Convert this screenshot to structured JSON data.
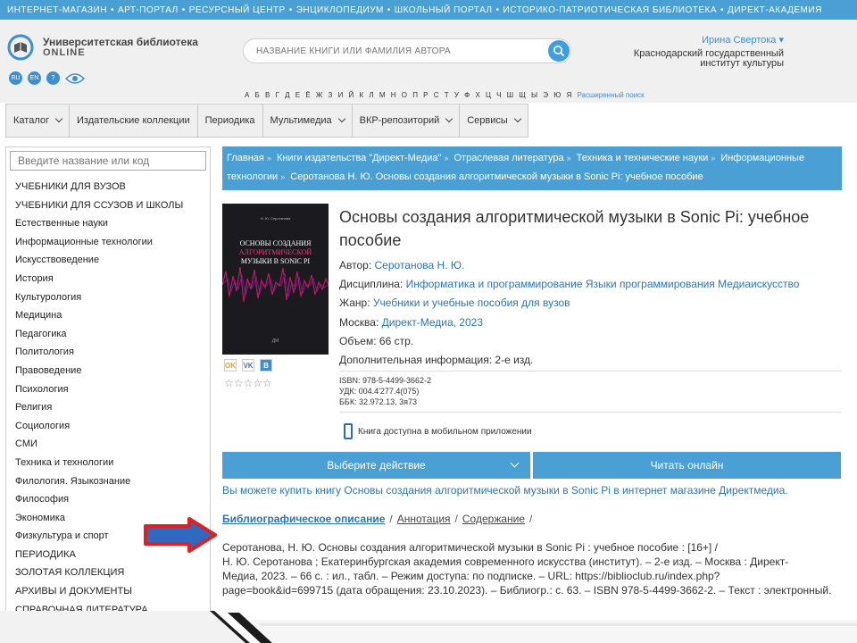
{
  "topbar": [
    "ИНТЕРНЕТ-МАГАЗИН",
    "АРТ-ПОРТАЛ",
    "РЕСУРСНЫЙ ЦЕНТР",
    "ЭНЦИКЛОПЕДИУМ",
    "ШКОЛЬНЫЙ ПОРТАЛ",
    "ИСТОРИКО-ПАТРИОТИЧЕСКАЯ БИБЛИОТЕКА",
    "ДИРЕКТ-АКАДЕМИЯ"
  ],
  "logo": {
    "line1": "Университетская библиотека",
    "line2": "ONLINE"
  },
  "langs": [
    "RU",
    "EN",
    "?"
  ],
  "search": {
    "placeholder": "НАЗВАНИЕ КНИГИ ИЛИ ФАМИЛИЯ АВТОРА"
  },
  "alphabet": "А Б В Г Д Е Ё Ж З И Й К Л М Н О П Р С Т У Ф Х Ц Ч Ш Щ Ы Э Ю Я",
  "advanced_search": "Расширенный поиск",
  "user": {
    "name": "Ирина Свертока ▾",
    "org1": "Краснодарский государственный",
    "org2": "институт культуры"
  },
  "nav": [
    {
      "label": "Каталог",
      "dropdown": true
    },
    {
      "label": "Издательские коллекции",
      "dropdown": false
    },
    {
      "label": "Периодика",
      "dropdown": false
    },
    {
      "label": "Мультимедиа",
      "dropdown": true
    },
    {
      "label": "ВКР-репозиторий",
      "dropdown": true
    },
    {
      "label": "Сервисы",
      "dropdown": true
    }
  ],
  "sidebar": {
    "placeholder": "Введите название или код",
    "items": [
      "УЧЕБНИКИ ДЛЯ ВУЗОВ",
      "УЧЕБНИКИ ДЛЯ ССУЗОВ И ШКОЛЫ",
      "Естественные науки",
      "Информационные технологии",
      "Искусствоведение",
      "История",
      "Культурология",
      "Медицина",
      "Педагогика",
      "Политология",
      "Правоведение",
      "Психология",
      "Религия",
      "Социология",
      "СМИ",
      "Техника и технологии",
      "Филология. Языкознание",
      "Философия",
      "Экономика",
      "Физкультура и спорт",
      "ПЕРИОДИКА",
      "ЗОЛОТАЯ КОЛЛЕКЦИЯ",
      "АРХИВЫ И ДОКУМЕНТЫ",
      "СПРАВОЧНАЯ ЛИТЕРАТУРА"
    ]
  },
  "breadcrumb": {
    "line1": [
      "Главная",
      "Книги издательства \"Директ-Медиа\"",
      "Отраслевая литература",
      "Техника и технические науки",
      "Информационные"
    ],
    "line2": [
      "технологии",
      "Серотанова Н. Ю. Основы создания алгоритмической музыки в Sonic Pi: учебное пособие"
    ]
  },
  "cover": {
    "author": "Н. Ю. Серотанова",
    "title1": "ОСНОВЫ СОЗДАНИЯ",
    "title2": "АЛГОРИТМИЧЕСКОЙ",
    "title3": "МУЗЫКИ В SONIC PI",
    "publisher": "ДМ"
  },
  "share": [
    "OK",
    "VK",
    "B"
  ],
  "rating": "☆☆☆☆☆",
  "book": {
    "title": "Основы создания алгоритмической музыки в Sonic Pi: учебное пособие",
    "author_label": "Автор:",
    "author": "Серотанова Н. Ю.",
    "discipline_label": "Дисциплина:",
    "discipline": "Информатика и программирование Языки программирования Медиаискусство",
    "genre_label": "Жанр:",
    "genre": "Учебники и учебные пособия для вузов",
    "city": "Москва:",
    "publisher": "Директ-Медиа, 2023",
    "pages": "Объем: 66 стр.",
    "extra": "Дополнительная информация: 2-е изд.",
    "isbn": "ISBN: 978-5-4499-3662-2",
    "udk": "УДК: 004.4'277.4(075)",
    "bbk": "ББК: 32.972.13, 3я73"
  },
  "mobile": "Книга доступна в мобильном приложении",
  "actions": {
    "choose": "Выберите действие",
    "read": "Читать онлайн"
  },
  "buy": "Вы можете купить книгу Основы создания алгоритмической музыки в Sonic Pi в интернет магазине Директмедиа.",
  "tabs": [
    "Библиографическое описание",
    "Аннотация",
    "Содержание"
  ],
  "biblio": {
    "line1": "Серотанова, Н. Ю. Основы создания алгоритмической музыки в Sonic Pi : учебное пособие : [16+] /",
    "line2": "Н. Ю. Серотанова ; Екатеринбургская академия современного искусства (институт). – 2-е изд. – Москва : Директ-",
    "line3": "Медиа, 2023. – 66 с. : ил., табл. – Режим доступа: по подписке. – URL: https://biblioclub.ru/index.php?",
    "line4": "page=book&id=699715 (дата обращения: 23.10.2023). – Библиогр.: с. 63. – ISBN 978-5-4499-3662-2. – Текст : электронный."
  },
  "colors": {
    "accent": "#4aa0d5",
    "link": "#2a76b7",
    "arrow_red": "#e02020",
    "arrow_blue": "#2f6ac0"
  }
}
